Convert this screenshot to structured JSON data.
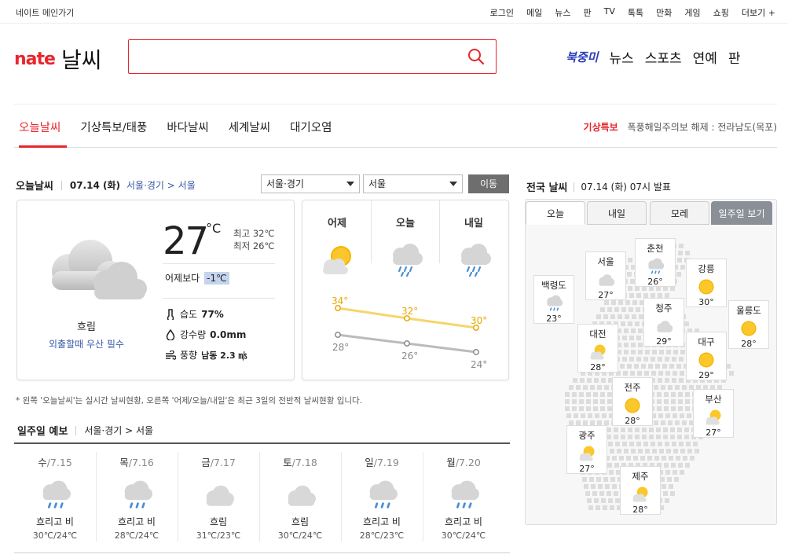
{
  "topbar": {
    "home": "네이트 메인가기",
    "links": [
      "로그인",
      "메일",
      "뉴스",
      "판",
      "TV",
      "톡톡",
      "만화",
      "게임",
      "쇼핑",
      "더보기 +"
    ]
  },
  "header": {
    "logo": "nate",
    "title": "날씨",
    "search_value": "",
    "brand": "북중미",
    "links": [
      "뉴스",
      "스포츠",
      "연예",
      "판"
    ]
  },
  "menu": {
    "items": [
      "오늘날씨",
      "기상특보/태풍",
      "바다날씨",
      "세계날씨",
      "대기오염"
    ],
    "alert_label": "기상특보",
    "alert_text": "폭풍해일주의보 해제 : 전라남도(목포)"
  },
  "today": {
    "title": "오늘날씨",
    "date": "07.14 (화)",
    "location": "서울·경기 > 서울",
    "region_select": "서울·경기",
    "city_select": "서울",
    "go_button": "이동",
    "temp": "27",
    "unit": "°C",
    "high": "최고 32℃",
    "low": "최저 26℃",
    "compare_label": "어제보다",
    "compare_value": "-1℃",
    "humidity_label": "습도",
    "humidity": "77%",
    "rain_label": "강수량",
    "rain": "0.0mm",
    "wind_label": "풍향",
    "wind": "남동 2.3 ㎧",
    "condition": "흐림",
    "advice": "외출할때 우산 필수"
  },
  "three_day": {
    "days": [
      "어제",
      "오늘",
      "내일"
    ],
    "high": [
      "34°",
      "32°",
      "30°"
    ],
    "low": [
      "28°",
      "26°",
      "24°"
    ]
  },
  "note": "* 왼쪽 '오늘날씨'는 실시간 날씨현황, 오른쪽 '어제/오늘/내일'은 최근 3일의 전반적 날씨현황 입니다.",
  "weekly": {
    "title": "일주일 예보",
    "location": "서울·경기 > 서울",
    "days": [
      {
        "day": "수",
        "date": "/7.15",
        "cond": "흐리고 비",
        "temp": "30℃/24℃",
        "icon": "rain-cloud"
      },
      {
        "day": "목",
        "date": "/7.16",
        "cond": "흐리고 비",
        "temp": "28℃/24℃",
        "icon": "rain-cloud"
      },
      {
        "day": "금",
        "date": "/7.17",
        "cond": "흐림",
        "temp": "31℃/23℃",
        "icon": "cloud"
      },
      {
        "day": "토",
        "date": "/7.18",
        "cond": "흐림",
        "temp": "30℃/24℃",
        "icon": "cloud"
      },
      {
        "day": "일",
        "date": "/7.19",
        "cond": "흐리고 비",
        "temp": "28℃/23℃",
        "icon": "rain-cloud"
      },
      {
        "day": "월",
        "date": "/7.20",
        "cond": "흐리고 비",
        "temp": "30℃/24℃",
        "icon": "rain-cloud"
      }
    ]
  },
  "national": {
    "title": "전국 날씨",
    "issued": "07.14 (화) 07시 발표",
    "tabs": [
      "오늘",
      "내일",
      "모레",
      "일주일 보기"
    ],
    "cities": [
      {
        "name": "백령도",
        "temp": "23°",
        "icon": "rain-cloud"
      },
      {
        "name": "서울",
        "temp": "27°",
        "icon": "cloud"
      },
      {
        "name": "춘천",
        "temp": "26°",
        "icon": "rain-cloud"
      },
      {
        "name": "강릉",
        "temp": "30°",
        "icon": "sun"
      },
      {
        "name": "울릉도",
        "temp": "28°",
        "icon": "sun"
      },
      {
        "name": "청주",
        "temp": "29°",
        "icon": "cloud"
      },
      {
        "name": "대전",
        "temp": "28°",
        "icon": "partly-cloudy"
      },
      {
        "name": "대구",
        "temp": "29°",
        "icon": "sun"
      },
      {
        "name": "전주",
        "temp": "28°",
        "icon": "sun"
      },
      {
        "name": "부산",
        "temp": "27°",
        "icon": "partly-cloudy"
      },
      {
        "name": "광주",
        "temp": "27°",
        "icon": "partly-cloudy"
      },
      {
        "name": "제주",
        "temp": "28°",
        "icon": "partly-cloudy"
      }
    ]
  },
  "colors": {
    "accent": "#e8262d",
    "link": "#3a5aa8",
    "high_line": "#f5d66a",
    "low_line": "#bbbbbb"
  }
}
